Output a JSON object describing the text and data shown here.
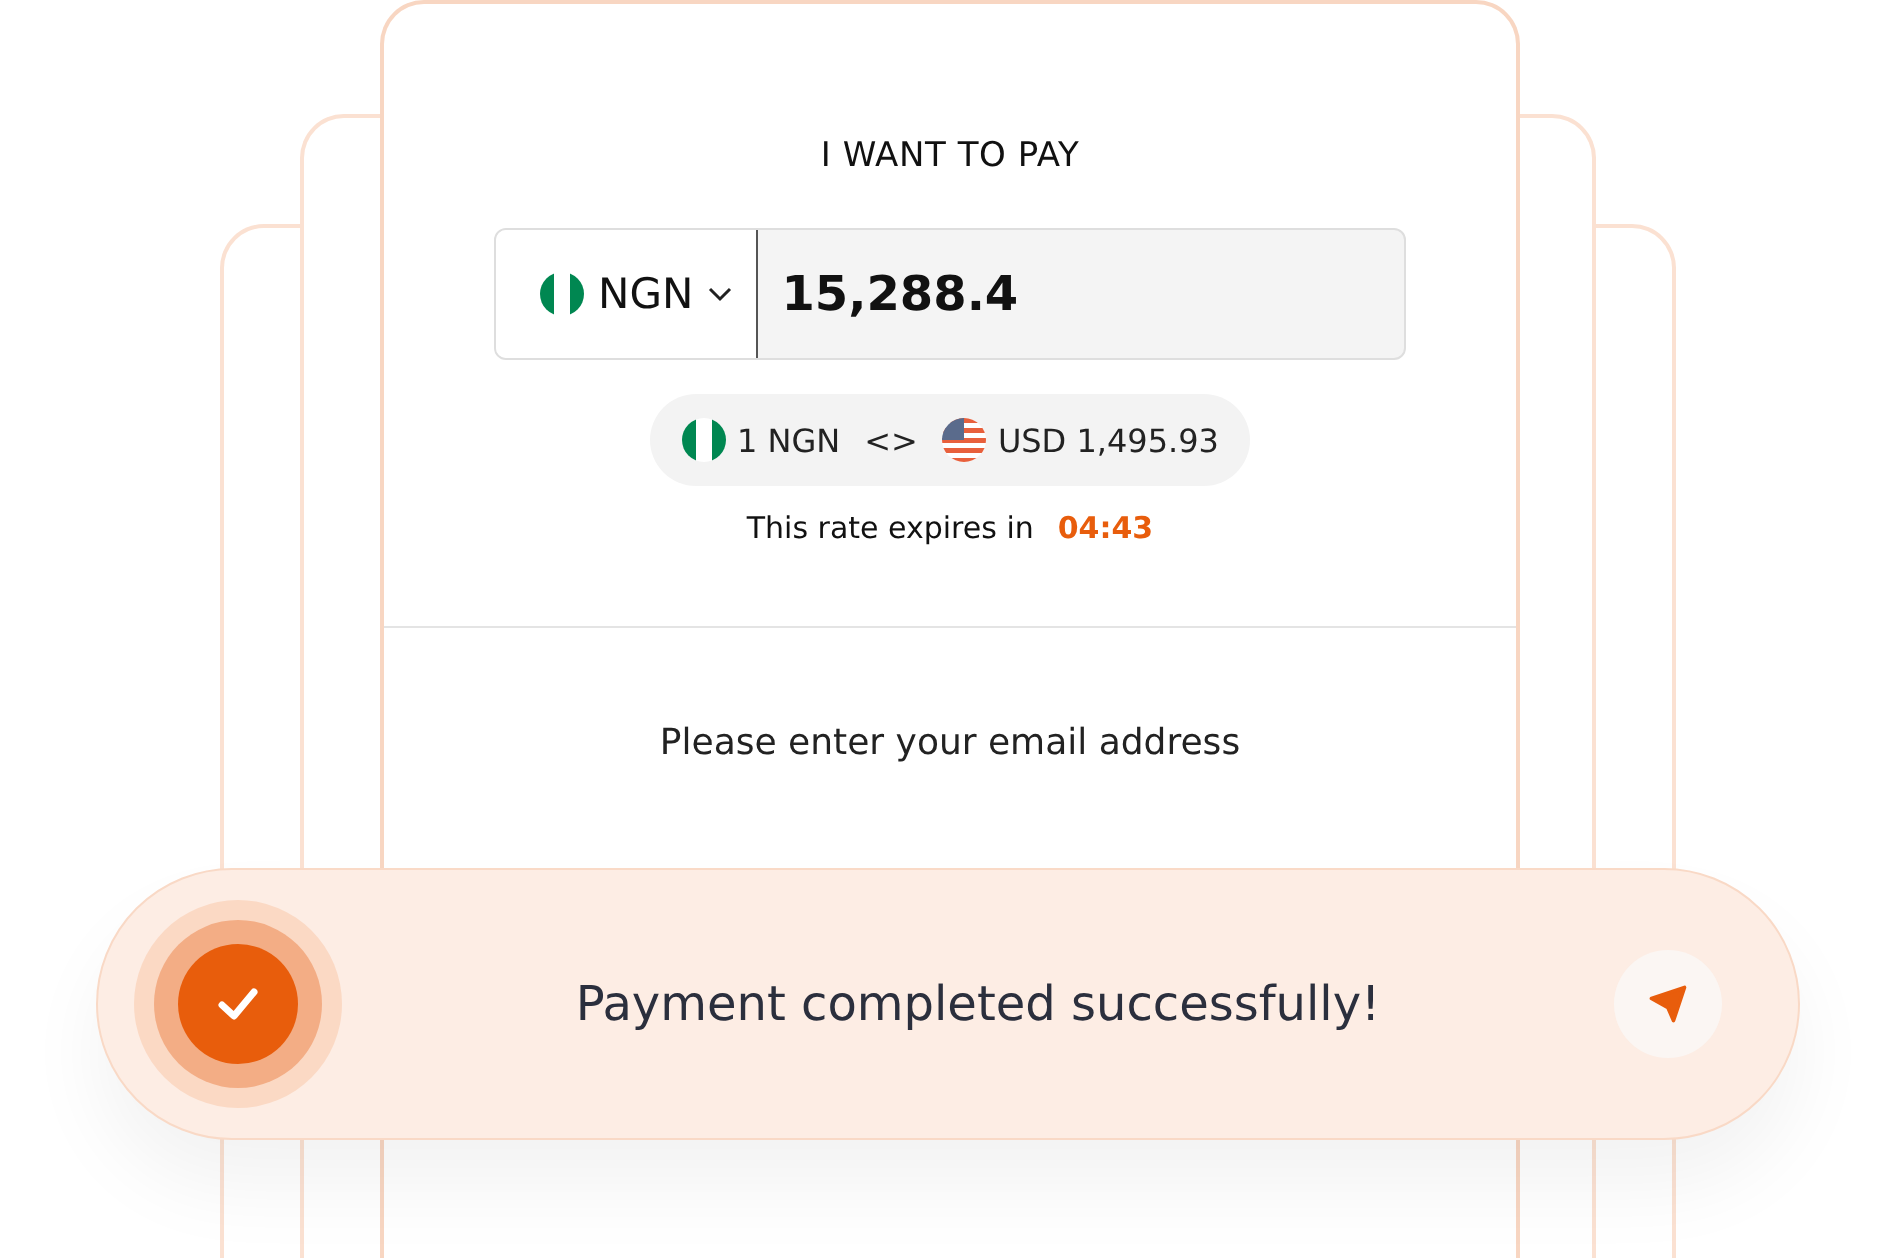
{
  "heading": "I WANT TO PAY",
  "currency": {
    "code": "NGN"
  },
  "amount": "15,288.4",
  "rate": {
    "from": "1 NGN",
    "separator": "<>",
    "to": "USD 1,495.93"
  },
  "expiry": {
    "label": "This rate expires in",
    "time": "04:43"
  },
  "email_prompt": "Please enter your email address",
  "toast": {
    "message": "Payment completed successfully!"
  }
}
